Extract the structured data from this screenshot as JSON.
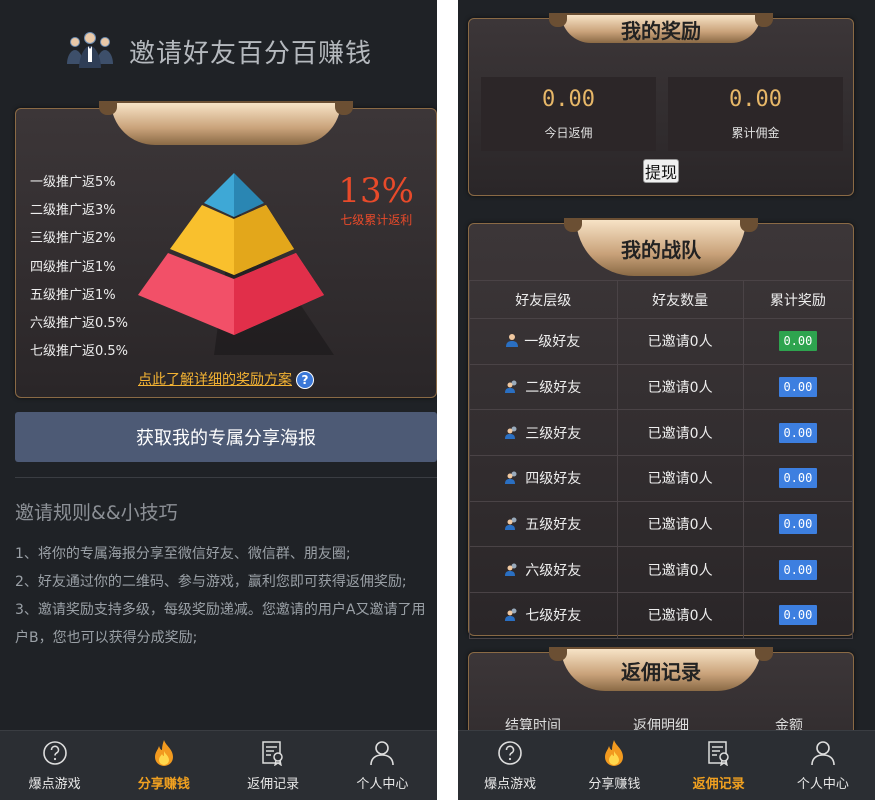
{
  "left": {
    "title": "邀请好友百分百赚钱",
    "levels": [
      "一级推广返5%",
      "二级推广返3%",
      "三级推广返2%",
      "四级推广返1%",
      "五级推广返1%",
      "六级推广返0.5%",
      "七级推广返0.5%"
    ],
    "percent": "13%",
    "percent_label": "七级累计返利",
    "detail_link": "点此了解详细的奖励方案",
    "help_glyph": "?",
    "poster_button": "获取我的专属分享海报",
    "rules_title": "邀请规则&&小技巧",
    "rules": [
      "1、将你的专属海报分享至微信好友、微信群、朋友圈;",
      "2、好友通过你的二维码、参与游戏，赢利您即可获得返佣奖励;",
      "3、邀请奖励支持多级，每级奖励递减。您邀请的用户A又邀请了用户B，您也可以获得分成奖励;"
    ],
    "tabs": [
      {
        "label": "爆点游戏",
        "icon": "question-circle-icon",
        "active": false
      },
      {
        "label": "分享赚钱",
        "icon": "flame-icon",
        "active": true
      },
      {
        "label": "返佣记录",
        "icon": "certificate-icon",
        "active": false
      },
      {
        "label": "个人中心",
        "icon": "user-icon",
        "active": false
      }
    ]
  },
  "right": {
    "rewards_title": "我的奖励",
    "today_value": "0.00",
    "today_label": "今日返佣",
    "total_value": "0.00",
    "total_label": "累计佣金",
    "withdraw_button": "提现",
    "team_title": "我的战队",
    "team_headers": [
      "好友层级",
      "好友数量",
      "累计奖励"
    ],
    "team_rows": [
      {
        "level": "一级好友",
        "count": "已邀请0人",
        "reward": "0.00"
      },
      {
        "level": "二级好友",
        "count": "已邀请0人",
        "reward": "0.00"
      },
      {
        "level": "三级好友",
        "count": "已邀请0人",
        "reward": "0.00"
      },
      {
        "level": "四级好友",
        "count": "已邀请0人",
        "reward": "0.00"
      },
      {
        "level": "五级好友",
        "count": "已邀请0人",
        "reward": "0.00"
      },
      {
        "level": "六级好友",
        "count": "已邀请0人",
        "reward": "0.00"
      },
      {
        "level": "七级好友",
        "count": "已邀请0人",
        "reward": "0.00"
      }
    ],
    "records_title": "返佣记录",
    "records_headers": [
      "结算时间",
      "返佣明细",
      "金额"
    ],
    "tabs": [
      {
        "label": "爆点游戏",
        "icon": "question-circle-icon",
        "active": false
      },
      {
        "label": "分享赚钱",
        "icon": "flame-icon",
        "active": false
      },
      {
        "label": "返佣记录",
        "icon": "certificate-icon",
        "active": true
      },
      {
        "label": "个人中心",
        "icon": "user-icon",
        "active": false
      }
    ]
  },
  "colors": {
    "accent": "#f0a020",
    "badge_green": "#2ea44f",
    "badge_blue": "#3d7fe0",
    "percent": "#e84a2a",
    "link": "#f2b233"
  }
}
